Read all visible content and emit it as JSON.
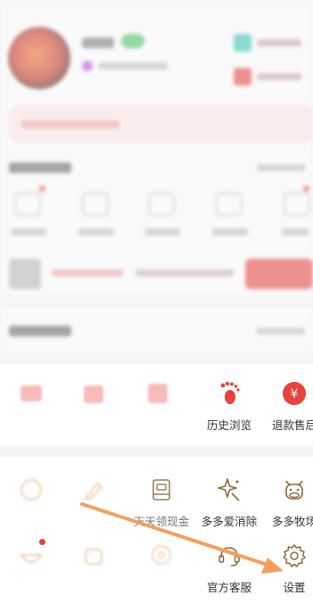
{
  "tools_row1": [
    {
      "label": "",
      "icon": "message-icon",
      "color": "#e9423c",
      "clear": false
    },
    {
      "label": "",
      "icon": "store-icon",
      "color": "#e9423c",
      "clear": false
    },
    {
      "label": "",
      "icon": "follow-icon",
      "color": "#e9423c",
      "clear": false
    },
    {
      "label": "历史浏览",
      "icon": "footprint-icon",
      "color": "#e9423c",
      "clear": true
    },
    {
      "label": "退款售后",
      "icon": "refund-icon",
      "color": "#e9423c",
      "clear": true
    }
  ],
  "tools_row2": [
    {
      "label": "",
      "icon": "coin-icon",
      "clear": false
    },
    {
      "label": "",
      "icon": "pen-icon",
      "clear": false
    },
    {
      "label": "天天领现金",
      "icon": "cash-box-icon",
      "clear": true
    },
    {
      "label": "多多爱消除",
      "icon": "sparkle-icon",
      "clear": true
    },
    {
      "label": "多多牧场",
      "icon": "cow-icon",
      "clear": true
    }
  ],
  "tools_row3": [
    {
      "label": "",
      "icon": "bowl-icon",
      "clear": false
    },
    {
      "label": "",
      "icon": "pot-icon",
      "clear": false
    },
    {
      "label": "",
      "icon": "location-icon",
      "clear": false
    },
    {
      "label": "官方客服",
      "icon": "headset-icon",
      "clear": true
    },
    {
      "label": "设置",
      "icon": "gear-icon",
      "clear": true
    }
  ],
  "colors": {
    "accent": "#e9423c",
    "icon_stroke": "#8a6a3c",
    "arrow": "#f5a05a"
  }
}
